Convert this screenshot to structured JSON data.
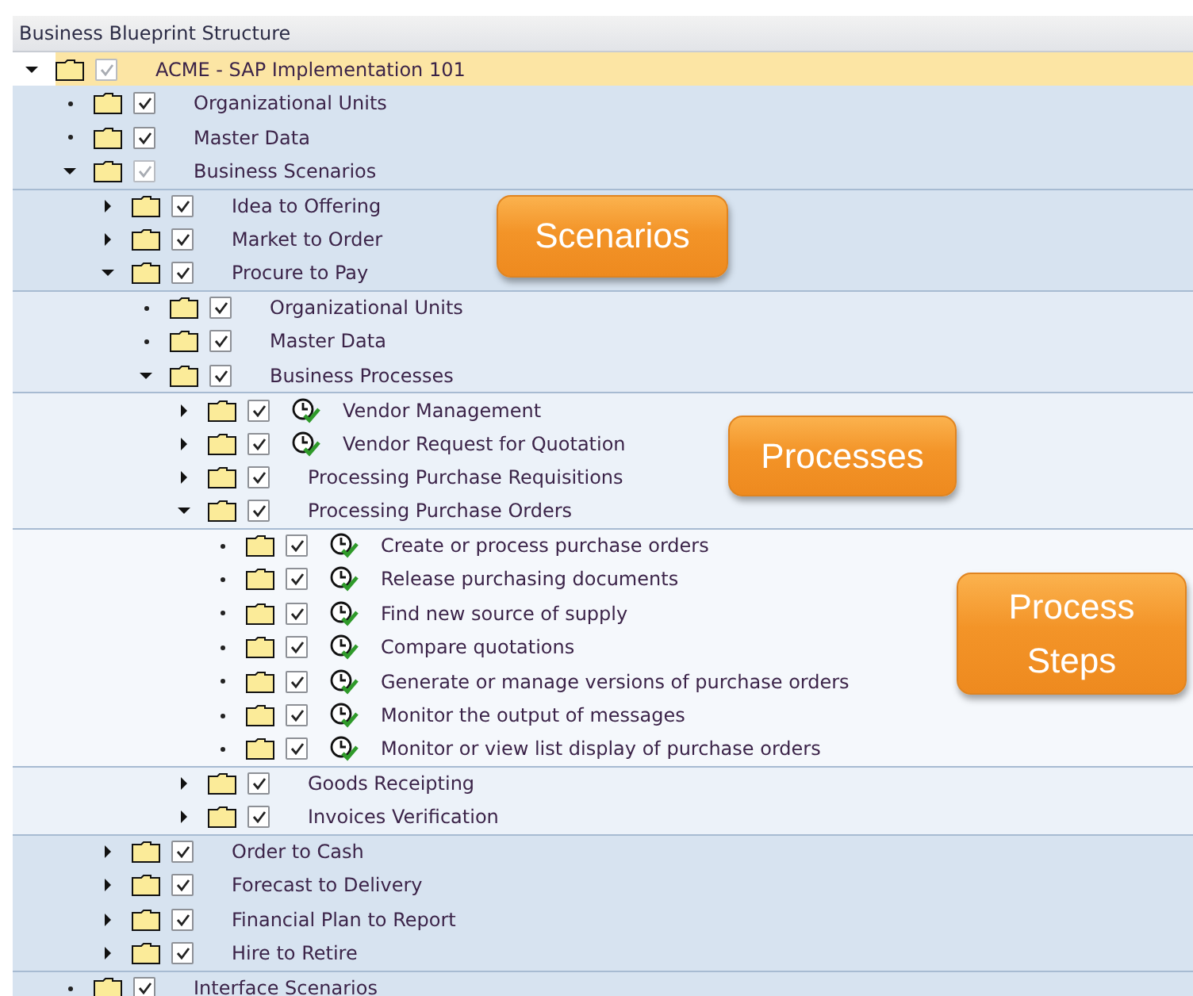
{
  "header": {
    "title": "Business Blueprint Structure"
  },
  "tree": [
    {
      "label": "ACME - SAP Implementation 101",
      "kind": "expanded",
      "selected": true,
      "checked": true,
      "disabled": true,
      "process_icon": false,
      "children": [
        {
          "label": "Organizational Units",
          "kind": "leaf",
          "selected": false,
          "checked": true,
          "disabled": false,
          "process_icon": false
        },
        {
          "label": "Master Data",
          "kind": "leaf",
          "selected": false,
          "checked": true,
          "disabled": false,
          "process_icon": false
        },
        {
          "label": "Business Scenarios",
          "kind": "expanded",
          "selected": false,
          "checked": true,
          "disabled": true,
          "process_icon": false,
          "children": [
            {
              "label": "Idea to Offering",
              "kind": "collapsed",
              "selected": false,
              "checked": true,
              "disabled": false,
              "process_icon": false
            },
            {
              "label": "Market to Order",
              "kind": "collapsed",
              "selected": false,
              "checked": true,
              "disabled": false,
              "process_icon": false
            },
            {
              "label": "Procure to Pay",
              "kind": "expanded",
              "selected": false,
              "checked": true,
              "disabled": false,
              "process_icon": false,
              "children": [
                {
                  "label": "Organizational Units",
                  "kind": "leaf",
                  "selected": false,
                  "checked": true,
                  "disabled": false,
                  "process_icon": false
                },
                {
                  "label": "Master Data",
                  "kind": "leaf",
                  "selected": false,
                  "checked": true,
                  "disabled": false,
                  "process_icon": false
                },
                {
                  "label": "Business Processes",
                  "kind": "expanded",
                  "selected": false,
                  "checked": true,
                  "disabled": false,
                  "process_icon": false,
                  "children": [
                    {
                      "label": "Vendor Management",
                      "kind": "collapsed",
                      "selected": false,
                      "checked": true,
                      "disabled": false,
                      "process_icon": true
                    },
                    {
                      "label": "Vendor Request for Quotation",
                      "kind": "collapsed",
                      "selected": false,
                      "checked": true,
                      "disabled": false,
                      "process_icon": true
                    },
                    {
                      "label": "Processing Purchase Requisitions",
                      "kind": "collapsed",
                      "selected": false,
                      "checked": true,
                      "disabled": false,
                      "process_icon": false
                    },
                    {
                      "label": "Processing Purchase Orders",
                      "kind": "expanded",
                      "selected": false,
                      "checked": true,
                      "disabled": false,
                      "process_icon": false,
                      "children": [
                        {
                          "label": "Create or process purchase orders",
                          "kind": "leaf",
                          "selected": false,
                          "checked": true,
                          "disabled": false,
                          "process_icon": true
                        },
                        {
                          "label": "Release purchasing documents",
                          "kind": "leaf",
                          "selected": false,
                          "checked": true,
                          "disabled": false,
                          "process_icon": true
                        },
                        {
                          "label": "Find new source of supply",
                          "kind": "leaf",
                          "selected": false,
                          "checked": true,
                          "disabled": false,
                          "process_icon": true
                        },
                        {
                          "label": "Compare quotations",
                          "kind": "leaf",
                          "selected": false,
                          "checked": true,
                          "disabled": false,
                          "process_icon": true
                        },
                        {
                          "label": "Generate or manage versions of purchase orders",
                          "kind": "leaf",
                          "selected": false,
                          "checked": true,
                          "disabled": false,
                          "process_icon": true
                        },
                        {
                          "label": "Monitor the output of messages",
                          "kind": "leaf",
                          "selected": false,
                          "checked": true,
                          "disabled": false,
                          "process_icon": true
                        },
                        {
                          "label": "Monitor or view list display of purchase orders",
                          "kind": "leaf",
                          "selected": false,
                          "checked": true,
                          "disabled": false,
                          "process_icon": true
                        }
                      ]
                    },
                    {
                      "label": "Goods Receipting",
                      "kind": "collapsed",
                      "selected": false,
                      "checked": true,
                      "disabled": false,
                      "process_icon": false
                    },
                    {
                      "label": "Invoices Verification",
                      "kind": "collapsed",
                      "selected": false,
                      "checked": true,
                      "disabled": false,
                      "process_icon": false
                    }
                  ]
                }
              ]
            },
            {
              "label": "Order to Cash",
              "kind": "collapsed",
              "selected": false,
              "checked": true,
              "disabled": false,
              "process_icon": false
            },
            {
              "label": "Forecast to Delivery",
              "kind": "collapsed",
              "selected": false,
              "checked": true,
              "disabled": false,
              "process_icon": false
            },
            {
              "label": "Financial Plan to Report",
              "kind": "collapsed",
              "selected": false,
              "checked": true,
              "disabled": false,
              "process_icon": false
            },
            {
              "label": "Hire to Retire",
              "kind": "collapsed",
              "selected": false,
              "checked": true,
              "disabled": false,
              "process_icon": false
            }
          ]
        },
        {
          "label": "Interface Scenarios",
          "kind": "leaf",
          "selected": false,
          "checked": true,
          "disabled": false,
          "process_icon": false
        }
      ]
    }
  ],
  "callouts": [
    {
      "text": "Scenarios"
    },
    {
      "text": "Processes"
    },
    {
      "text": "Process Steps"
    }
  ]
}
